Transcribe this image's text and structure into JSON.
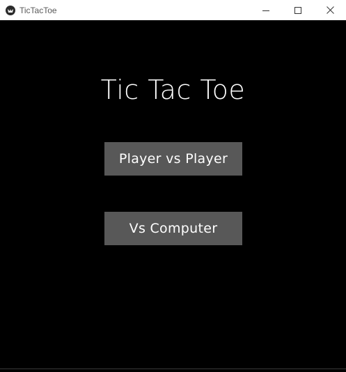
{
  "window": {
    "title": "TicTacToe",
    "controls": [
      "minimize-icon",
      "maximize-icon",
      "close-icon"
    ]
  },
  "main": {
    "heading": "Tic Tac Toe",
    "buttons": [
      {
        "label": "Player vs Player"
      },
      {
        "label": "Vs Computer"
      }
    ]
  },
  "colors": {
    "background": "#000000",
    "button": "#585858",
    "text": "#ffffff"
  }
}
